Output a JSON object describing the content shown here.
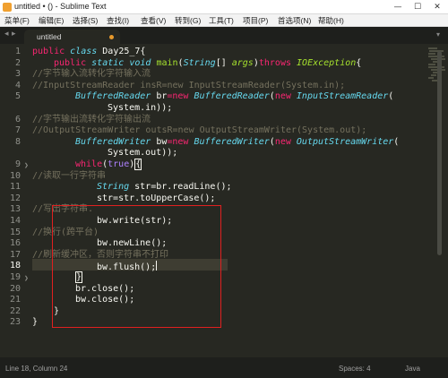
{
  "window": {
    "title": "untitled • () - Sublime Text",
    "controls": {
      "minimize": "—",
      "maximize": "☐",
      "close": "✕"
    }
  },
  "menu": [
    "菜单(F)",
    "编辑(E)",
    "选择(S)",
    "查找(I)",
    "查看(V)",
    "转到(G)",
    "工具(T)",
    "项目(P)",
    "首选项(N)",
    "帮助(H)"
  ],
  "tabs": {
    "nav_left": "◂",
    "nav_right": "▸",
    "dropdown": "▾",
    "active_tab": {
      "label": "untitled",
      "dirty": true
    }
  },
  "editor": {
    "line_numbers": [
      "1",
      "2",
      "3",
      "4",
      "5",
      "6",
      "7",
      "8",
      "9",
      "10",
      "11",
      "12",
      "13",
      "14",
      "15",
      "16",
      "17",
      "18",
      "19",
      "20",
      "21",
      "22",
      "23"
    ],
    "current_line": "18",
    "fold_markers": {
      "line9": "❯",
      "line19": "❯"
    },
    "code": {
      "l1": {
        "kw1": "public",
        "kw2": "class",
        "name": " Day25_7{"
      },
      "l2": {
        "kw1": "public",
        "st": "static",
        "ty": "void",
        "fn": "main",
        "p1": "(",
        "ty2": "String",
        "p2": "[] ",
        "arg": "args",
        "p3": ")",
        "kw2": "throws",
        "ex": "IOException",
        "p4": "{"
      },
      "l3": "//字节输入流转化字符输入流",
      "l4": "//InputStreamReader insR=new InputStreamReader(System.in);",
      "l5": {
        "ty": "BufferedReader",
        "v": " br",
        "op": "=",
        "kw": "new",
        "ty2": "BufferedReader",
        "p": "(",
        "kw2": "new",
        "ty3": "InputStreamReader",
        "p2": "("
      },
      "l6": "System.in));",
      "l7": "//字节输出流转化字符输出流",
      "l8": "//OutputStreamWriter outsR=new OutputStreamWriter(System.out);",
      "l9": {
        "ty": "BufferedWriter",
        "v": " bw",
        "op": "=",
        "kw": "new",
        "ty2": "BufferedWriter",
        "p": "(",
        "kw2": "new",
        "ty3": "OutputStreamWriter",
        "p2": "("
      },
      "l10": "System.out));",
      "l11": {
        "kw": "while",
        "p1": "(",
        "bl": "true",
        "p2": ")",
        "br": "{"
      },
      "l12": "//读取一行字符串",
      "l13": {
        "ty": "String",
        "rest": " str=br.readLine();"
      },
      "l14": "str=str.toUpperCase();",
      "l15": "//写出字符串.",
      "l16": "bw.write(str);",
      "l17": "//换行(跨平台)",
      "l18": "bw.newLine();",
      "l19": "//刷新缓冲区，否则字符串不打印",
      "l20": "bw.flush();",
      "l21": "}",
      "l22": "br.close();",
      "l23": "bw.close();",
      "l24": "}",
      "l25": "}"
    }
  },
  "status_bar": {
    "position": "Line 18, Column 24",
    "indentation": "Spaces: 4",
    "syntax": "Java"
  },
  "colors": {
    "background": "#272822",
    "keyword": "#f92672",
    "type": "#66d9ef",
    "function": "#a6e22e",
    "comment": "#75715e",
    "annotation_box": "#e02020"
  }
}
